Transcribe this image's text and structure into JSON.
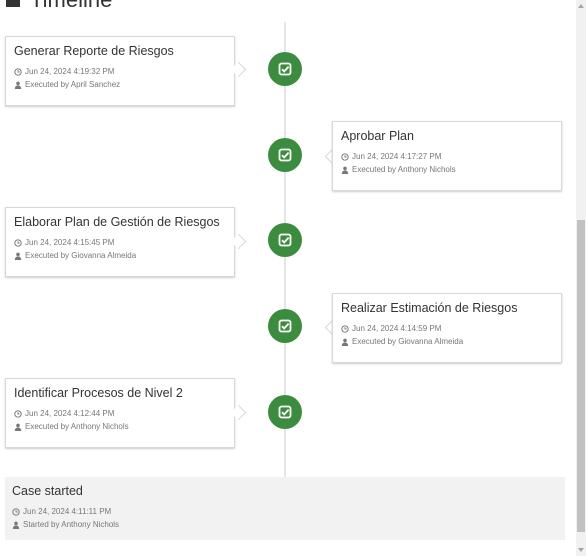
{
  "header": {
    "title": "Timeline"
  },
  "timeline": [
    {
      "title": "Generar Reporte de Riesgos",
      "timestamp": "Jun 24, 2024 4:19:32 PM",
      "executed": "Executed by April Sanchez"
    },
    {
      "title": "Aprobar Plan",
      "timestamp": "Jun 24, 2024 4:17:27 PM",
      "executed": "Executed by Anthony Nichols"
    },
    {
      "title": "Elaborar Plan de Gestión de Riesgos",
      "timestamp": "Jun 24, 2024 4:15:45 PM",
      "executed": "Executed by Giovanna Almeida"
    },
    {
      "title": "Realizar Estimación de Riesgos",
      "timestamp": "Jun 24, 2024 4:14:59 PM",
      "executed": "Executed by Giovanna Almeida"
    },
    {
      "title": "Identificar Procesos de Nivel 2",
      "timestamp": "Jun 24, 2024 4:12:44 PM",
      "executed": "Executed by Anthony Nichols"
    }
  ],
  "case_started": {
    "title": "Case started",
    "timestamp": "Jun 24, 2024 4:11:11 PM",
    "started_by": "Started by Anthony Nichols"
  },
  "colors": {
    "node": "#3c8c3f",
    "line": "#e5e5e5",
    "panel": "#f2f2f2"
  },
  "icons": {
    "node": "check-square-icon",
    "time": "clock-icon",
    "user": "user-icon"
  }
}
